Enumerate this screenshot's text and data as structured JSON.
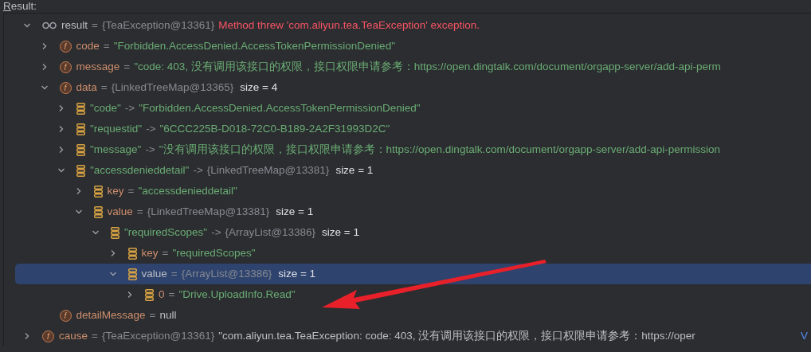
{
  "header": {
    "title": "Result:"
  },
  "tree": [
    {
      "kind": "watch",
      "expanded": true,
      "selected": false,
      "label": "result",
      "op": "=",
      "ref": "{TeaException@13361}",
      "error": "Method threw 'com.aliyun.tea.TeaException' exception.",
      "children": [
        {
          "kind": "field",
          "badge": "f",
          "expanded": false,
          "selected": false,
          "name": "code",
          "op": "=",
          "string": "\"Forbidden.AccessDenied.AccessTokenPermissionDenied\""
        },
        {
          "kind": "field",
          "badge": "f",
          "expanded": false,
          "selected": false,
          "name": "message",
          "op": "=",
          "string": "\"code: 403, 没有调用该接口的权限，接口权限申请参考：https://open.dingtalk.com/document/orgapp-server/add-api-perm"
        },
        {
          "kind": "field",
          "badge": "f",
          "expanded": true,
          "selected": false,
          "name": "data",
          "op": "=",
          "ref": "{LinkedTreeMap@13365}",
          "size": "size = 4",
          "children": [
            {
              "kind": "entry",
              "expanded": false,
              "selected": false,
              "key": "\"code\"",
              "op": "->",
              "string": "\"Forbidden.AccessDenied.AccessTokenPermissionDenied\""
            },
            {
              "kind": "entry",
              "expanded": false,
              "selected": false,
              "key": "\"requestid\"",
              "op": "->",
              "string": "\"6CCC225B-D018-72C0-B189-2A2F31993D2C\""
            },
            {
              "kind": "entry",
              "expanded": false,
              "selected": false,
              "key": "\"message\"",
              "op": "->",
              "string": "\"没有调用该接口的权限，接口权限申请参考：https://open.dingtalk.com/document/orgapp-server/add-api-permission"
            },
            {
              "kind": "entry",
              "expanded": true,
              "selected": false,
              "key": "\"accessdenieddetail\"",
              "op": "->",
              "ref": "{LinkedTreeMap@13381}",
              "size": "size = 1",
              "children": [
                {
                  "kind": "entry",
                  "expanded": false,
                  "selected": false,
                  "name": "key",
                  "op": "=",
                  "string": "\"accessdenieddetail\""
                },
                {
                  "kind": "entry",
                  "expanded": true,
                  "selected": false,
                  "name": "value",
                  "op": "=",
                  "ref": "{LinkedTreeMap@13381}",
                  "size": "size = 1",
                  "children": [
                    {
                      "kind": "entry",
                      "expanded": true,
                      "selected": false,
                      "key": "\"requiredScopes\"",
                      "op": "->",
                      "ref": "{ArrayList@13386}",
                      "size": "size = 1",
                      "children": [
                        {
                          "kind": "entry",
                          "expanded": false,
                          "selected": false,
                          "name": "key",
                          "op": "=",
                          "string": "\"requiredScopes\""
                        },
                        {
                          "kind": "entry",
                          "expanded": true,
                          "selected": true,
                          "label": "value",
                          "op": "=",
                          "ref": "{ArrayList@13386}",
                          "size": "size = 1",
                          "children": [
                            {
                              "kind": "entry",
                              "expanded": false,
                              "selected": false,
                              "name": "0",
                              "op": "=",
                              "string": "\"Drive.UploadInfo.Read\""
                            }
                          ]
                        }
                      ]
                    }
                  ]
                }
              ]
            }
          ]
        },
        {
          "kind": "field",
          "badge": "f",
          "selected": false,
          "name": "detailMessage",
          "op": "=",
          "value": "null"
        }
      ]
    },
    {
      "kind": "field",
      "badge": "f",
      "expanded": false,
      "selected": false,
      "name": "cause",
      "op": "=",
      "ref": "{TeaException@13361}",
      "value": "\"com.aliyun.tea.TeaException: code: 403, 没有调用该接口的权限，接口权限申请参考：https://oper",
      "trailing": "V"
    }
  ]
}
